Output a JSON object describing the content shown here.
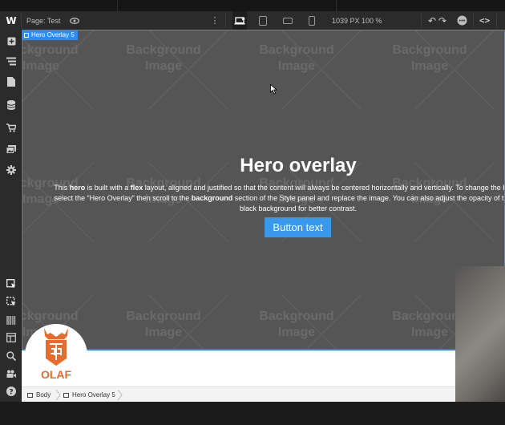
{
  "toolbar": {
    "logo": "W",
    "page_label": "Page: Test",
    "canvas_width": "1039 PX",
    "zoom": "100 %",
    "icons": [
      "eye-icon",
      "more-vertical-icon",
      "desktop-icon",
      "tablet-icon",
      "mobile-landscape-icon",
      "mobile-portrait-icon",
      "undo-icon",
      "redo-icon",
      "more-icon",
      "code-icon"
    ]
  },
  "sidebar": {
    "icons": [
      "add-icon",
      "navigator-icon",
      "pages-icon",
      "cms-icon",
      "ecommerce-icon",
      "assets-icon",
      "settings-icon",
      "select-icon",
      "select-outline-icon",
      "barcode-icon",
      "layout-icon",
      "search-icon",
      "video-icon",
      "help-icon"
    ]
  },
  "hero": {
    "selection_label": "Hero Overlay 5",
    "title": "Hero overlay",
    "para": [
      {
        "t": "This ",
        "b": false
      },
      {
        "t": "hero",
        "b": true
      },
      {
        "t": " is built with a ",
        "b": false
      },
      {
        "t": "flex",
        "b": true
      },
      {
        "t": " layout, aligned and justified so that the content will always be centered horizontally and vertically. To change the background, select the “Hero Overlay” then scroll to the ",
        "b": false
      },
      {
        "t": "background",
        "b": true
      },
      {
        "t": " section of the Style panel and replace the image. You can also adjust the opacity of the overlay’s black background for better contrast.",
        "b": false
      }
    ],
    "button_label": "Button text",
    "bg_placeholder_line1": "Background",
    "bg_placeholder_line2": "Image"
  },
  "logo": {
    "text": "OLAF",
    "color": "#e86a2c"
  },
  "breadcrumb": {
    "items": [
      "Body",
      "Hero Overlay 5"
    ]
  },
  "colors": {
    "accent": "#2d8bf3",
    "button": "#3898ec",
    "overlay": "#555555"
  }
}
